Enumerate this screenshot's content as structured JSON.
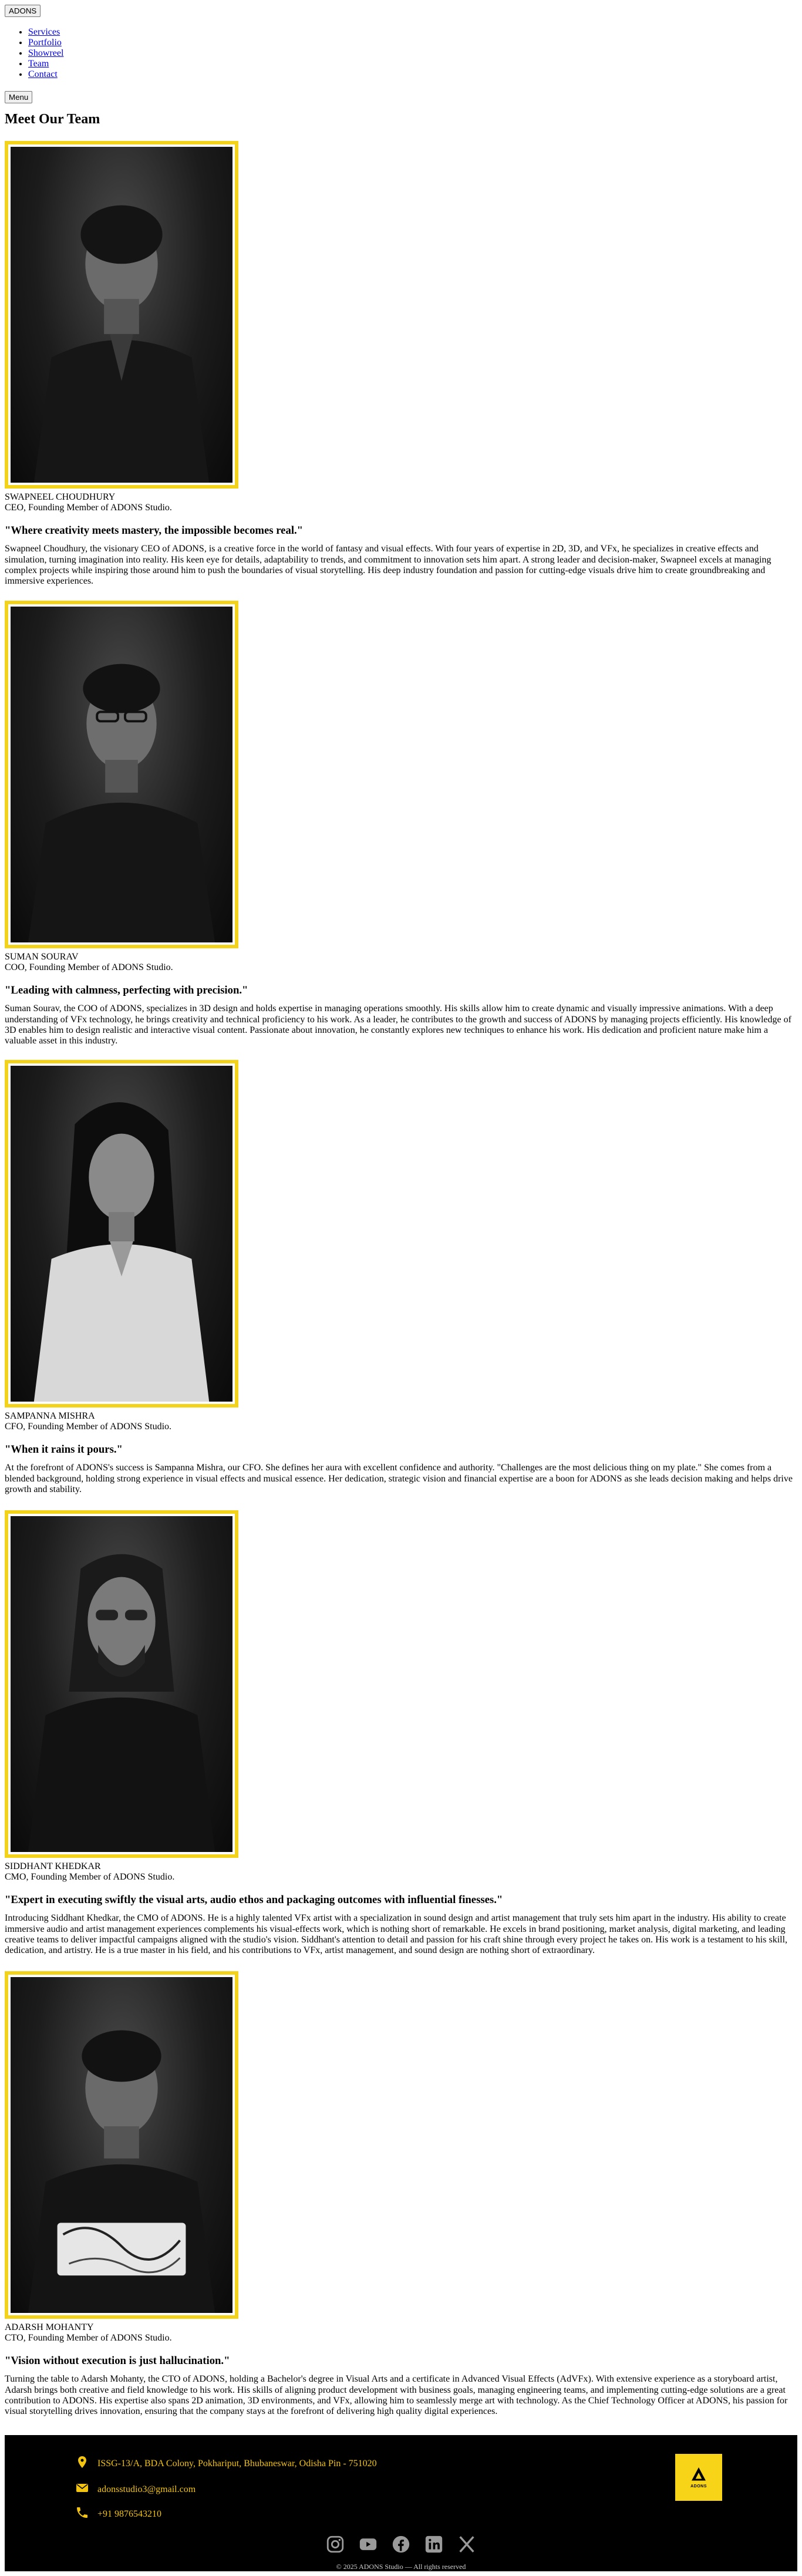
{
  "top_button_label": "ADONS",
  "nav": {
    "items": [
      "Services",
      "Portfolio",
      "Showreel",
      "Team",
      "Contact"
    ]
  },
  "menu_button_label": "Menu",
  "page_title": "Meet Our Team",
  "members": [
    {
      "name": "SWAPNEEL CHOUDHURY",
      "role": "CEO, Founding Member of ADONS Studio.",
      "quote": "\"Where creativity meets mastery, the impossible becomes real.\"",
      "bio": "Swapneel Choudhury, the visionary CEO of ADONS, is a creative force in the world of fantasy and visual effects. With four years of expertise in 2D, 3D, and VFx, he specializes in creative effects and simulation, turning imagination into reality. His keen eye for details, adaptability to trends, and commitment to innovation sets him apart. A strong leader and decision-maker, Swapneel excels at managing complex projects while inspiring those around him to push the boundaries of visual storytelling. His deep industry foundation and passion for cutting-edge visuals drive him to create groundbreaking and immersive experiences."
    },
    {
      "name": "SUMAN SOURAV",
      "role": "COO, Founding Member of ADONS Studio.",
      "quote": "\"Leading with calmness, perfecting with precision.\"",
      "bio": "Suman Sourav, the COO of ADONS, specializes in 3D design and holds expertise in managing operations smoothly. His skills allow him to create dynamic and visually impressive animations. With a deep understanding of VFx technology, he brings creativity and technical proficiency to his work. As a leader, he contributes to the growth and success of ADONS by managing projects efficiently. His knowledge of 3D enables him to design realistic and interactive visual content. Passionate about innovation, he constantly explores new techniques to enhance his work. His dedication and proficient nature make him a valuable asset in this industry."
    },
    {
      "name": "SAMPANNA MISHRA",
      "role": "CFO, Founding Member of ADONS Studio.",
      "quote": "\"When it rains it pours.\"",
      "bio": "At the forefront of ADONS's success is Sampanna Mishra, our CFO. She defines her aura with excellent confidence and authority. \"Challenges are the most delicious thing on my plate.\" She comes from a blended background, holding strong experience in visual effects and musical essence. Her dedication, strategic vision and financial expertise are a boon for ADONS as she leads decision making and helps drive growth and stability."
    },
    {
      "name": "SIDDHANT KHEDKAR",
      "role": "CMO, Founding Member of ADONS Studio.",
      "quote": "\"Expert in executing swiftly the visual arts, audio ethos and packaging outcomes with influential finesses.\"",
      "bio": "Introducing Siddhant Khedkar, the CMO of ADONS. He is a highly talented VFx artist with a specialization in sound design and artist management that truly sets him apart in the industry. His ability to create immersive audio and artist management experiences complements his visual-effects work, which is nothing short of remarkable. He excels in brand positioning, market analysis, digital marketing, and leading creative teams to deliver impactful campaigns aligned with the studio's vision. Siddhant's attention to detail and passion for his craft shine through every project he takes on. His work is a testament to his skill, dedication, and artistry. He is a true master in his field, and his contributions to VFx, artist management, and sound design are nothing short of extraordinary."
    },
    {
      "name": "ADARSH MOHANTY",
      "role": "CTO, Founding Member of ADONS Studio.",
      "quote": "\"Vision without execution is just hallucination.\"",
      "bio": "Turning the table to Adarsh Mohanty, the CTO of ADONS, holding a Bachelor's degree in Visual Arts and a certificate in Advanced Visual Effects (AdVFx). With extensive experience as a storyboard artist, Adarsh brings both creative and field knowledge to his work. His skills of aligning product development with business goals, managing engineering teams, and implementing cutting-edge solutions are a great contribution to ADONS. His expertise also spans 2D animation, 3D environments, and VFx, allowing him to seamlessly merge art with technology. As the Chief Technology Officer at ADONS, his passion for visual storytelling drives innovation, ensuring that the company stays at the forefront of delivering high quality digital experiences."
    }
  ],
  "footer": {
    "address": "ISSG-13/A, BDA Colony, Pokhariput, Bhubaneswar, Odisha   Pin - 751020",
    "email": "adonsstudio3@gmail.com",
    "phone": "+91 9876543210",
    "logo_text": "ADONS",
    "copyright": "© 2025 ADONS Studio — All rights reserved",
    "accent_color": "#f2c40f",
    "icons": [
      "location-pin-icon",
      "mail-icon",
      "phone-icon"
    ],
    "socials": [
      "instagram-icon",
      "youtube-icon",
      "facebook-icon",
      "linkedin-icon",
      "x-icon"
    ]
  }
}
